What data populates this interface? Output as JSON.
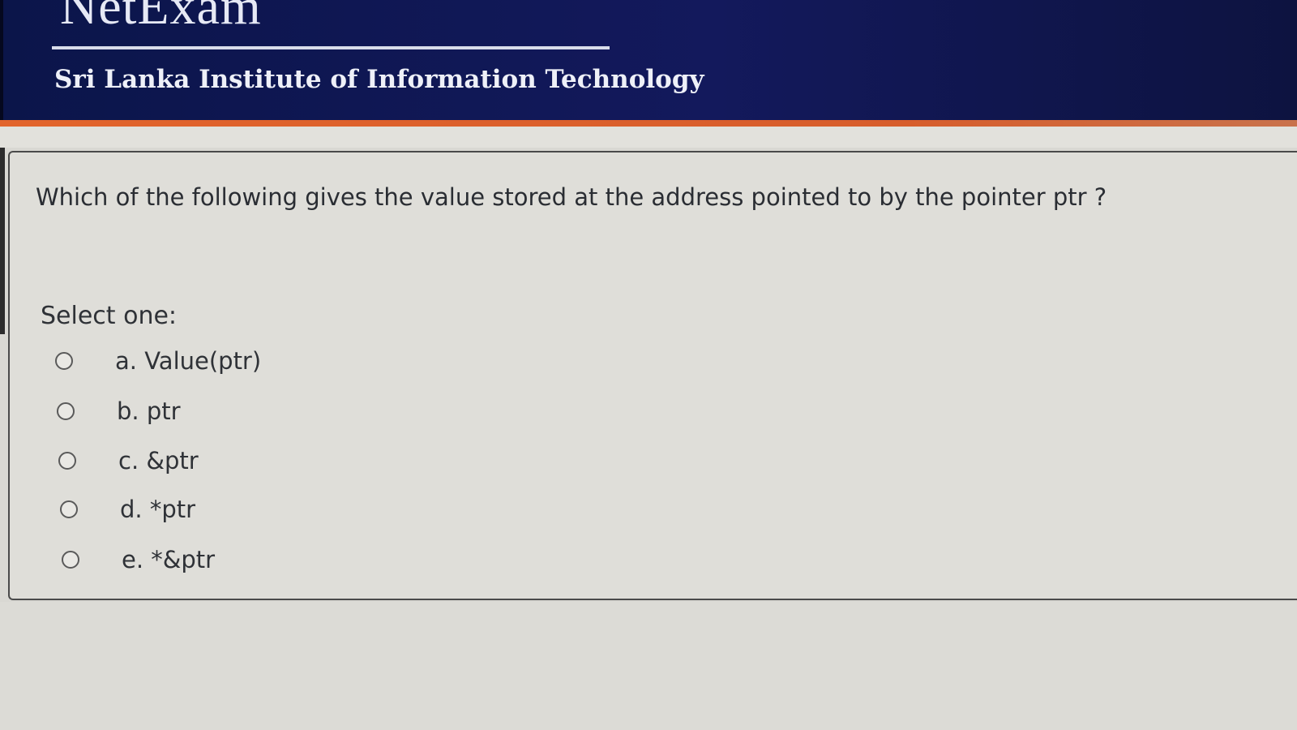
{
  "header": {
    "brand": "NetExam",
    "institute": "Sri Lanka Institute of Information Technology"
  },
  "question": {
    "text": "Which of the following gives the value stored at the address pointed to by the pointer ptr ?",
    "select_label": "Select one:",
    "options": [
      {
        "label": "a. Value(ptr)",
        "selected": false
      },
      {
        "label": "b. ptr",
        "selected": false
      },
      {
        "label": "c. &ptr",
        "selected": false
      },
      {
        "label": "d. *ptr",
        "selected": false
      },
      {
        "label": "e. *&ptr",
        "selected": false
      }
    ]
  },
  "colors": {
    "header_bg": "#13195c",
    "accent_orange": "#e2642c",
    "page_bg": "#d9d8d3"
  }
}
